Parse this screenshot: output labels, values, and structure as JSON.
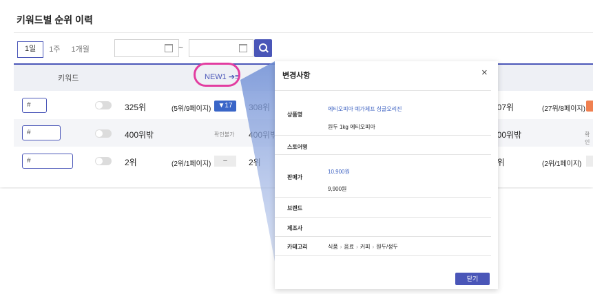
{
  "page": {
    "title": "키워드별 순위 이력"
  },
  "filters": {
    "periods": [
      "1일",
      "1주",
      "1개월"
    ],
    "active_period": "1일",
    "date_from": "",
    "date_to": "",
    "range_separator": "~"
  },
  "table": {
    "col_keyword": "키워드",
    "col_new": "NEW1 ➔≡",
    "rows": [
      {
        "keyword_value": "#",
        "rank1": "325위",
        "detail1": "(5위/9페이지)",
        "badge": "▼17",
        "rank2": "308위",
        "rank3": "307위",
        "detail3": "(27위/8페이지)"
      },
      {
        "keyword_value": "#",
        "rank1": "400위밖",
        "detail1": "확인불가",
        "rank2": "400위밖",
        "rank3": "400위밖",
        "detail3": "확인"
      },
      {
        "keyword_value": "#",
        "rank1": "2위",
        "detail1": "(2위/1페이지)",
        "badge": "–",
        "rank2": "2위",
        "rank3": "2위",
        "detail3": "(2위/1페이지)"
      }
    ]
  },
  "modal": {
    "title": "변경사항",
    "close_icon": "×",
    "fields": {
      "product_label": "상품명",
      "product_new": "에티오피아 예가체프 싱글오리진",
      "product_old": "원두 1kg 에티오피아",
      "store_label": "스토어명",
      "price_label": "판매가",
      "price_new": "10,900원",
      "price_old": "9,900원",
      "brand_label": "브랜드",
      "maker_label": "제조사",
      "category_label": "카테고리",
      "category_path": [
        "식품",
        "음료",
        "커피",
        "원두/생두"
      ]
    },
    "close_button": "닫기"
  },
  "colors": {
    "accent": "#4a56b8",
    "highlight": "#e23ca0",
    "badge_down": "#3a66c8",
    "badge_orange": "#f08050"
  }
}
